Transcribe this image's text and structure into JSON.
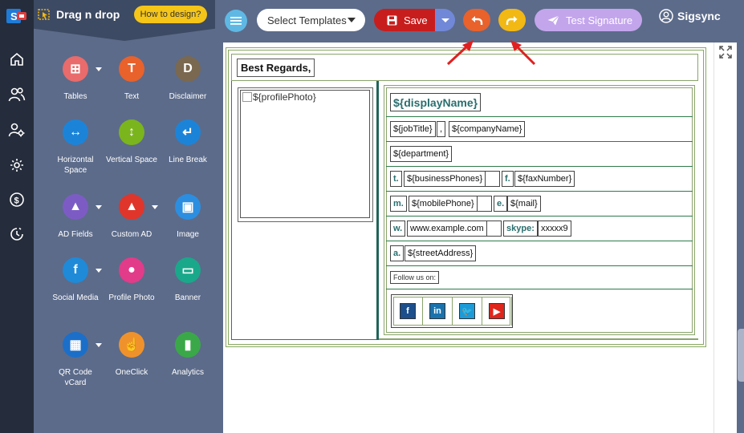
{
  "panel": {
    "title": "Drag n drop",
    "howto": "How to design?",
    "tools": [
      {
        "label": "Tables",
        "color": "#e96b6b",
        "glyph": "⊞",
        "caret": true
      },
      {
        "label": "Text",
        "color": "#e9612b",
        "glyph": "T",
        "caret": false
      },
      {
        "label": "Disclaimer",
        "color": "#7a6850",
        "glyph": "D",
        "caret": false
      },
      {
        "label": "Horizontal Space",
        "color": "#1c84d8",
        "glyph": "↔",
        "caret": false
      },
      {
        "label": "Vertical Space",
        "color": "#7ab51d",
        "glyph": "↕",
        "caret": false
      },
      {
        "label": "Line Break",
        "color": "#1c84d8",
        "glyph": "↵",
        "caret": false
      },
      {
        "label": "AD Fields",
        "color": "#7c5cc4",
        "glyph": "▲",
        "caret": true
      },
      {
        "label": "Custom AD",
        "color": "#e0352b",
        "glyph": "▲",
        "caret": true
      },
      {
        "label": "Image",
        "color": "#2c8ee0",
        "glyph": "▣",
        "caret": false
      },
      {
        "label": "Social Media",
        "color": "#1f8ad8",
        "glyph": "f",
        "caret": true
      },
      {
        "label": "Profile Photo",
        "color": "#e23b8a",
        "glyph": "●",
        "caret": false
      },
      {
        "label": "Banner",
        "color": "#1aa88a",
        "glyph": "▭",
        "caret": false
      },
      {
        "label": "QR Code vCard",
        "color": "#1c6fc8",
        "glyph": "▦",
        "caret": true
      },
      {
        "label": "OneClick",
        "color": "#f0922b",
        "glyph": "☝",
        "caret": false
      },
      {
        "label": "Analytics",
        "color": "#3aa848",
        "glyph": "▮",
        "caret": false
      }
    ]
  },
  "toolbar": {
    "select_templates": "Select Templates",
    "save": "Save",
    "test_signature": "Test Signature",
    "user": "Sigsync"
  },
  "signature": {
    "greeting": "Best Regards,",
    "profile_photo_alt": "${profilePhoto}",
    "display_name": "${displayName}",
    "job_title": "${jobTitle}",
    "comma": ",",
    "company_name": "${companyName}",
    "department": "${department}",
    "t_label": "t.",
    "business_phones": "${businessPhones}",
    "f_label": "f.",
    "fax_number": "${faxNumber}",
    "m_label": "m.",
    "mobile_phone": "${mobilePhone}",
    "e_label": "e.",
    "mail": "${mail}",
    "w_label": "w.",
    "website": "www.example.com",
    "skype_label": "skype:",
    "skype_value": "xxxxx9",
    "a_label": "a.",
    "street_address": "${streetAddress}",
    "follow_us": "Follow us on:",
    "social": [
      {
        "icon": "facebook-icon",
        "glyph": "f",
        "color": "#1d4f8c"
      },
      {
        "icon": "linkedin-icon",
        "glyph": "in",
        "color": "#1a72ad"
      },
      {
        "icon": "twitter-icon",
        "glyph": "🐦",
        "color": "#1d9bd8"
      },
      {
        "icon": "youtube-icon",
        "glyph": "▶",
        "color": "#e0261c"
      }
    ]
  }
}
